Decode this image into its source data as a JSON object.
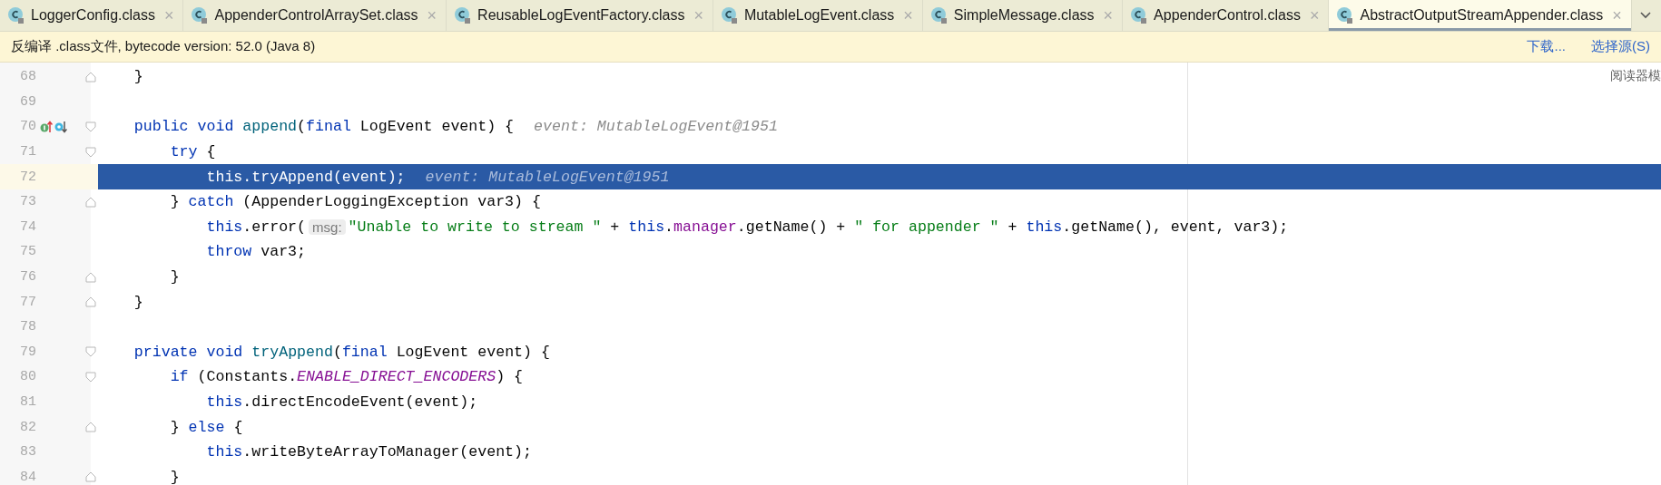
{
  "tabs": [
    {
      "label": "LoggerConfig.class",
      "close": "×",
      "selected": false
    },
    {
      "label": "AppenderControlArraySet.class",
      "close": "×",
      "selected": false
    },
    {
      "label": "ReusableLogEventFactory.class",
      "close": "×",
      "selected": false
    },
    {
      "label": "MutableLogEvent.class",
      "close": "×",
      "selected": false
    },
    {
      "label": "SimpleMessage.class",
      "close": "×",
      "selected": false
    },
    {
      "label": "AppenderControl.class",
      "close": "×",
      "selected": false
    },
    {
      "label": "AbstractOutputStreamAppender.class",
      "close": "×",
      "selected": true
    }
  ],
  "notice": {
    "text": "反编译 .class文件, bytecode version: 52.0 (Java 8)",
    "links": [
      "下载...",
      "选择源(S)"
    ]
  },
  "reader_mode": "阅读器模",
  "lines": [
    {
      "number": "68",
      "fold_start": false,
      "fold_end": true,
      "gutter_icons": false,
      "selected": false,
      "segments": [
        {
          "kind": "code",
          "tokens": [
            {
              "kind": "plain",
              "text": "    }"
            }
          ]
        }
      ]
    },
    {
      "number": "69",
      "fold_start": false,
      "fold_end": false,
      "gutter_icons": false,
      "selected": false
    },
    {
      "number": "70",
      "fold_start": true,
      "fold_end": false,
      "gutter_icons": true,
      "selected": false,
      "segments": [
        {
          "kind": "code",
          "tokens": [
            {
              "kind": "kw",
              "text": "    public void "
            },
            {
              "kind": "decl",
              "text": "append"
            },
            {
              "kind": "plain",
              "text": "("
            },
            {
              "kind": "kw",
              "text": "final "
            },
            {
              "kind": "plain",
              "text": "LogEvent event) {"
            }
          ]
        },
        {
          "kind": "hint",
          "text": "event: MutableLogEvent@1951"
        }
      ]
    },
    {
      "number": "71",
      "fold_start": true,
      "fold_end": false,
      "gutter_icons": false,
      "selected": false,
      "segments": [
        {
          "kind": "code",
          "tokens": [
            {
              "kind": "kw",
              "text": "        try "
            },
            {
              "kind": "plain",
              "text": "{"
            }
          ]
        }
      ]
    },
    {
      "number": "72",
      "fold_start": false,
      "fold_end": false,
      "gutter_icons": false,
      "selected": true,
      "segments": [
        {
          "kind": "code",
          "tokens": [
            {
              "kind": "kw",
              "text": "            this"
            },
            {
              "kind": "plain",
              "text": ".tryAppend(event);"
            }
          ]
        },
        {
          "kind": "hint",
          "text": "event: MutableLogEvent@1951"
        }
      ]
    },
    {
      "number": "73",
      "fold_start": false,
      "fold_end": true,
      "gutter_icons": false,
      "selected": false,
      "segments": [
        {
          "kind": "code",
          "tokens": [
            {
              "kind": "plain",
              "text": "        } "
            },
            {
              "kind": "kw",
              "text": "catch "
            },
            {
              "kind": "plain",
              "text": "(AppenderLoggingException var3) {"
            }
          ]
        }
      ]
    },
    {
      "number": "74",
      "fold_start": false,
      "fold_end": false,
      "gutter_icons": false,
      "selected": false,
      "segments": [
        {
          "kind": "code",
          "tokens": [
            {
              "kind": "kw",
              "text": "            this"
            },
            {
              "kind": "plain",
              "text": ".error("
            }
          ]
        },
        {
          "kind": "param",
          "text": "msg:"
        },
        {
          "kind": "code",
          "tokens": [
            {
              "kind": "str",
              "text": "\"Unable to write to stream \""
            },
            {
              "kind": "plain",
              "text": " + "
            },
            {
              "kind": "kw",
              "text": "this"
            },
            {
              "kind": "plain",
              "text": "."
            },
            {
              "kind": "field",
              "text": "manager"
            },
            {
              "kind": "plain",
              "text": ".getName() + "
            },
            {
              "kind": "str",
              "text": "\" for appender \""
            },
            {
              "kind": "plain",
              "text": " + "
            },
            {
              "kind": "kw",
              "text": "this"
            },
            {
              "kind": "plain",
              "text": ".getName(), event, var3);"
            }
          ]
        }
      ]
    },
    {
      "number": "75",
      "fold_start": false,
      "fold_end": false,
      "gutter_icons": false,
      "selected": false,
      "segments": [
        {
          "kind": "code",
          "tokens": [
            {
              "kind": "kw",
              "text": "            throw "
            },
            {
              "kind": "plain",
              "text": "var3;"
            }
          ]
        }
      ]
    },
    {
      "number": "76",
      "fold_start": false,
      "fold_end": true,
      "gutter_icons": false,
      "selected": false,
      "segments": [
        {
          "kind": "code",
          "tokens": [
            {
              "kind": "plain",
              "text": "        }"
            }
          ]
        }
      ]
    },
    {
      "number": "77",
      "fold_start": false,
      "fold_end": true,
      "gutter_icons": false,
      "selected": false,
      "segments": [
        {
          "kind": "code",
          "tokens": [
            {
              "kind": "plain",
              "text": "    }"
            }
          ]
        }
      ]
    },
    {
      "number": "78",
      "fold_start": false,
      "fold_end": false,
      "gutter_icons": false,
      "selected": false
    },
    {
      "number": "79",
      "fold_start": true,
      "fold_end": false,
      "gutter_icons": false,
      "selected": false,
      "segments": [
        {
          "kind": "code",
          "tokens": [
            {
              "kind": "kw",
              "text": "    private void "
            },
            {
              "kind": "decl",
              "text": "tryAppend"
            },
            {
              "kind": "plain",
              "text": "("
            },
            {
              "kind": "kw",
              "text": "final "
            },
            {
              "kind": "plain",
              "text": "LogEvent event) {"
            }
          ]
        }
      ]
    },
    {
      "number": "80",
      "fold_start": true,
      "fold_end": false,
      "gutter_icons": false,
      "selected": false,
      "segments": [
        {
          "kind": "code",
          "tokens": [
            {
              "kind": "kw",
              "text": "        if "
            },
            {
              "kind": "plain",
              "text": "(Constants."
            },
            {
              "kind": "static",
              "text": "ENABLE_DIRECT_ENCODERS"
            },
            {
              "kind": "plain",
              "text": ") {"
            }
          ]
        }
      ]
    },
    {
      "number": "81",
      "fold_start": false,
      "fold_end": false,
      "gutter_icons": false,
      "selected": false,
      "segments": [
        {
          "kind": "code",
          "tokens": [
            {
              "kind": "kw",
              "text": "            this"
            },
            {
              "kind": "plain",
              "text": ".directEncodeEvent(event);"
            }
          ]
        }
      ]
    },
    {
      "number": "82",
      "fold_start": false,
      "fold_end": true,
      "gutter_icons": false,
      "selected": false,
      "segments": [
        {
          "kind": "code",
          "tokens": [
            {
              "kind": "plain",
              "text": "        } "
            },
            {
              "kind": "kw",
              "text": "else "
            },
            {
              "kind": "plain",
              "text": "{"
            }
          ]
        }
      ]
    },
    {
      "number": "83",
      "fold_start": false,
      "fold_end": false,
      "gutter_icons": false,
      "selected": false,
      "segments": [
        {
          "kind": "code",
          "tokens": [
            {
              "kind": "kw",
              "text": "            this"
            },
            {
              "kind": "plain",
              "text": ".writeByteArrayToManager(event);"
            }
          ]
        }
      ]
    },
    {
      "number": "84",
      "fold_start": false,
      "fold_end": true,
      "gutter_icons": false,
      "selected": false,
      "segments": [
        {
          "kind": "code",
          "tokens": [
            {
              "kind": "plain",
              "text": "        }"
            }
          ]
        }
      ]
    }
  ]
}
